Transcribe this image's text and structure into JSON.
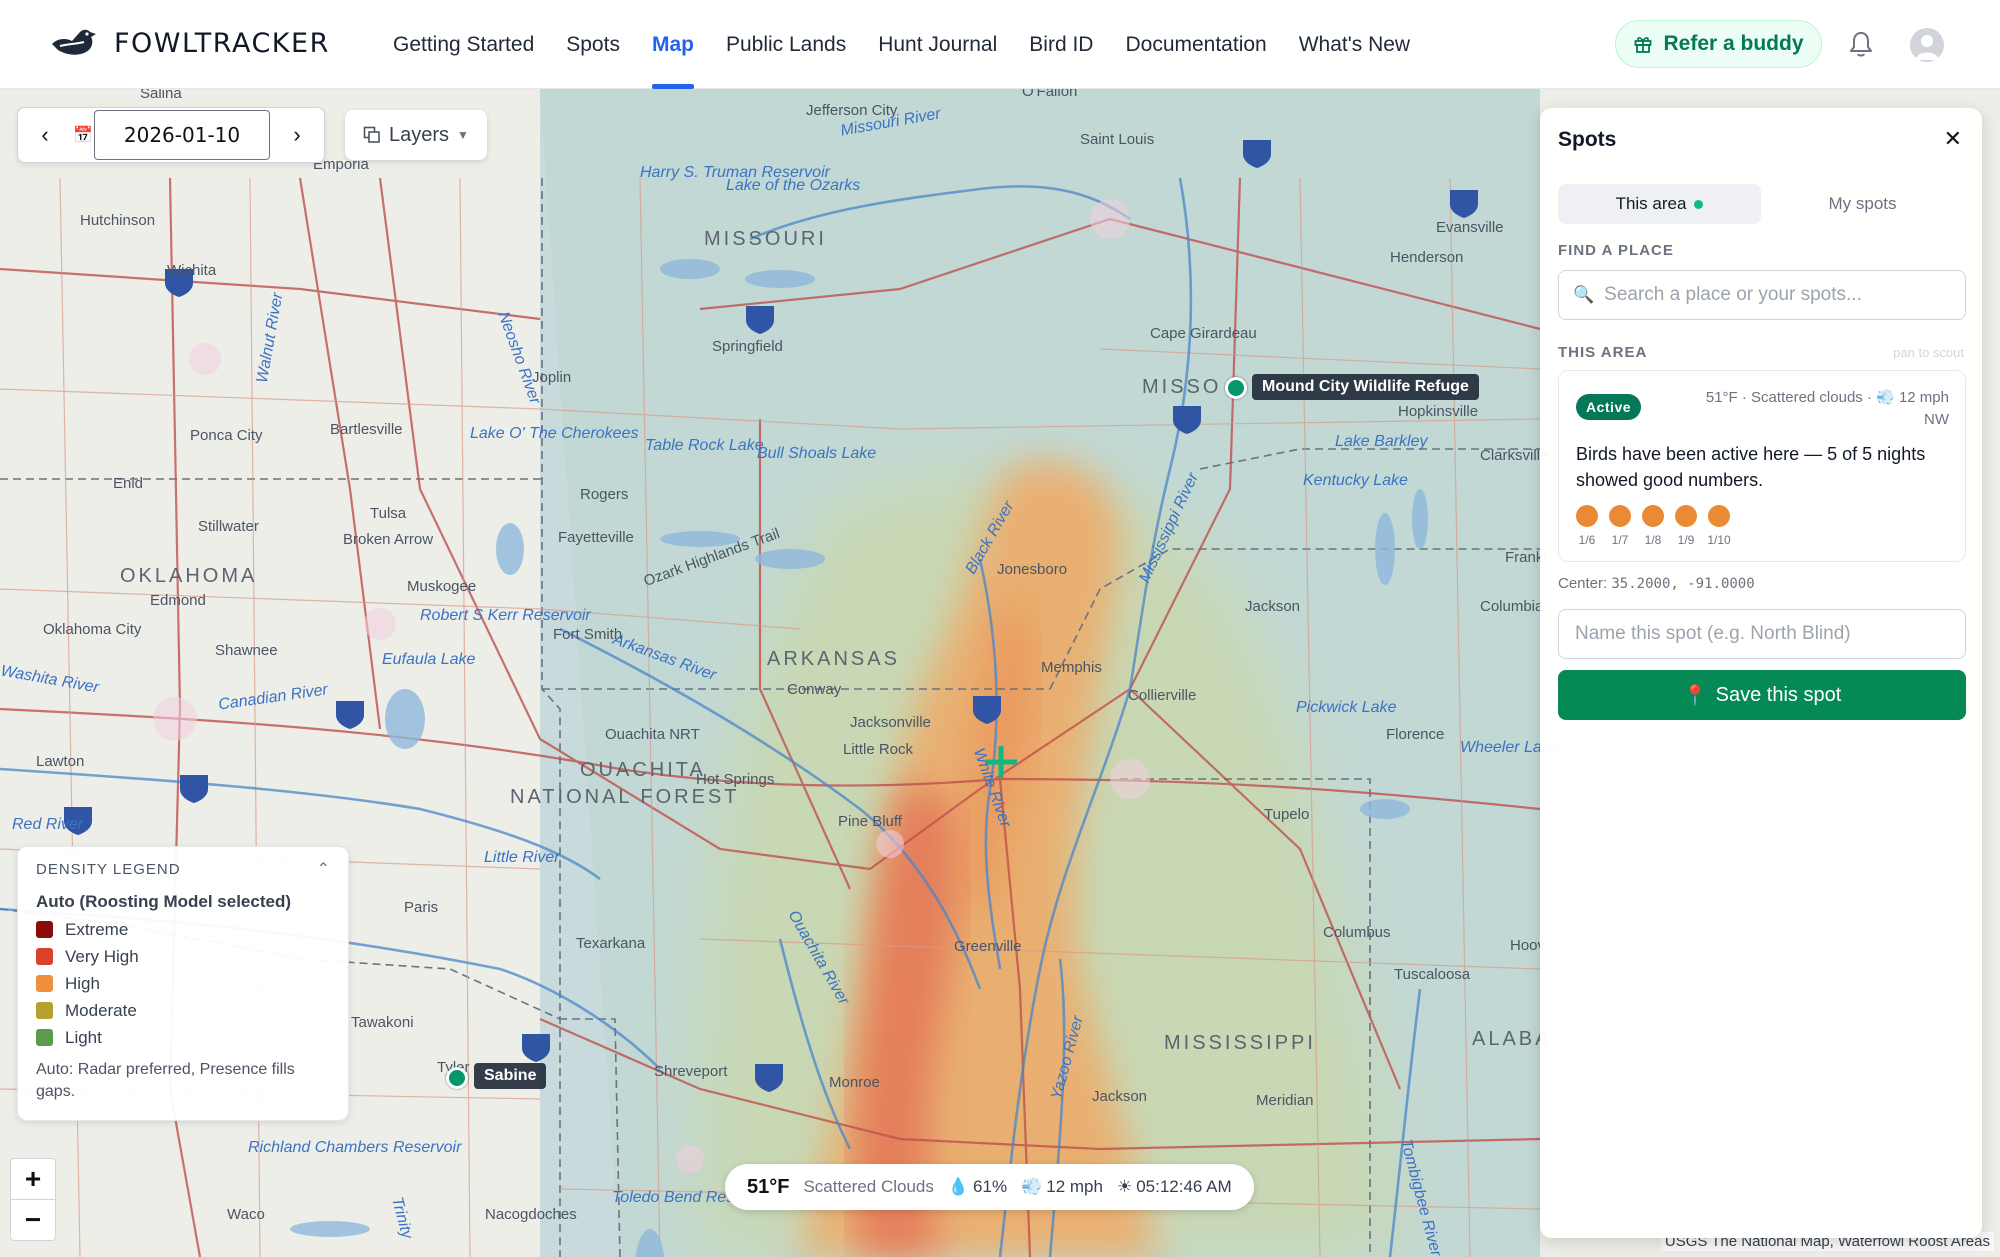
{
  "header": {
    "brand": "FOWLTRACKER",
    "nav": [
      "Getting Started",
      "Spots",
      "Map",
      "Public Lands",
      "Hunt Journal",
      "Bird ID",
      "Documentation",
      "What's New"
    ],
    "active_nav": "Map",
    "refer_label": "Refer a buddy",
    "accent_color": "#2563eb"
  },
  "map_controls": {
    "date": "2026-01-10",
    "prev_icon": "chevron-left-icon",
    "next_icon": "chevron-right-icon",
    "layers_label": "Layers"
  },
  "map_labels": {
    "states": [
      "MISSOURI",
      "ARKANSAS",
      "OKLAHOMA",
      "MISSISSIPPI",
      "MISSO",
      "ALABA"
    ],
    "cities": [
      "Salina",
      "Emporia",
      "Hutchinson",
      "Wichita",
      "Ponca City",
      "Bartlesville",
      "Enid",
      "Stillwater",
      "Tulsa",
      "Broken Arrow",
      "Edmond",
      "Oklahoma City",
      "Shawnee",
      "Muskogee",
      "Lawton",
      "Paris",
      "Tyler",
      "Waco",
      "Nacogdoches",
      "Texarkana",
      "Shreveport",
      "Monroe",
      "Greenville",
      "Jackson",
      "Pine Bluff",
      "Little Rock",
      "Jacksonville",
      "Conway",
      "Hot Springs",
      "Fayetteville",
      "Rogers",
      "Fort Smith",
      "Joplin",
      "Springfield",
      "Jefferson City",
      "Saint Louis",
      "O'Fallon",
      "Cape Girardeau",
      "Jonesboro",
      "Memphis",
      "Collierville",
      "Tupelo",
      "Columbus",
      "Tuscaloosa",
      "Meridian",
      "Florence",
      "Jackson",
      "Evansville",
      "Henderson",
      "Hopkinsville",
      "Clarksville",
      "Columbia",
      "Frankl",
      "Hoov",
      "Tawakoni"
    ],
    "features": [
      "Harry S. Truman Reservoir",
      "Lake of the Ozarks",
      "Table Rock Lake",
      "Bull Shoals Lake",
      "Lake O' The Cherokees",
      "Robert S Kerr Reservoir",
      "Eufaula Lake",
      "Ouachita NRT",
      "OUACHITA",
      "NATIONAL FOREST",
      "Richland Chambers Reservoir",
      "Toledo Bend Reservoir",
      "Kentucky Lake",
      "Lake Barkley",
      "Pickwick Lake",
      "Wheeler Lake",
      "Ozark Highlands Trail"
    ],
    "rivers": [
      "Missouri River",
      "Mississippi River",
      "Arkansas River",
      "Canadian River",
      "Red River",
      "White River",
      "Yazoo River",
      "Ouachita River",
      "Black River",
      "Neosho River",
      "Walnut River",
      "Little River",
      "Washita River",
      "Trinity",
      "Tombigbee River"
    ]
  },
  "markers": [
    {
      "name": "Mound City Wildlife Refuge"
    },
    {
      "name": "Sabine"
    }
  ],
  "legend": {
    "title": "DENSITY LEGEND",
    "mode": "Auto (Roosting Model selected)",
    "items": [
      {
        "label": "Extreme",
        "color": "#8b0a0a"
      },
      {
        "label": "Very High",
        "color": "#d9412b"
      },
      {
        "label": "High",
        "color": "#f0903a"
      },
      {
        "label": "Moderate",
        "color": "#b5a030"
      },
      {
        "label": "Light",
        "color": "#5c9a4e"
      }
    ],
    "note": "Auto: Radar preferred, Presence fills gaps."
  },
  "zoom": {
    "in": "+",
    "out": "−"
  },
  "weather": {
    "temp": "51°F",
    "conditions": "Scattered Clouds",
    "humidity": "61%",
    "wind": "12 mph",
    "time": "05:12:46 AM"
  },
  "attribution": "USGS The National Map, Waterfowl Roost Areas",
  "panel": {
    "title": "Spots",
    "tabs": [
      "This area",
      "My spots"
    ],
    "find_label": "FIND A PLACE",
    "search_placeholder": "Search a place or your spots...",
    "area_label": "THIS AREA",
    "pan_hint": "pan to scout",
    "card": {
      "status": "Active",
      "weather": "51°F · Scattered clouds · 💨 12 mph NW",
      "summary": "Birds have been active here — 5 of 5 nights showed good numbers.",
      "nights": [
        "1/6",
        "1/7",
        "1/8",
        "1/9",
        "1/10"
      ]
    },
    "center_label": "Center:",
    "center_value": "35.2000, -91.0000",
    "name_placeholder": "Name this spot (e.g. North Blind)",
    "save_label": "Save this spot"
  }
}
